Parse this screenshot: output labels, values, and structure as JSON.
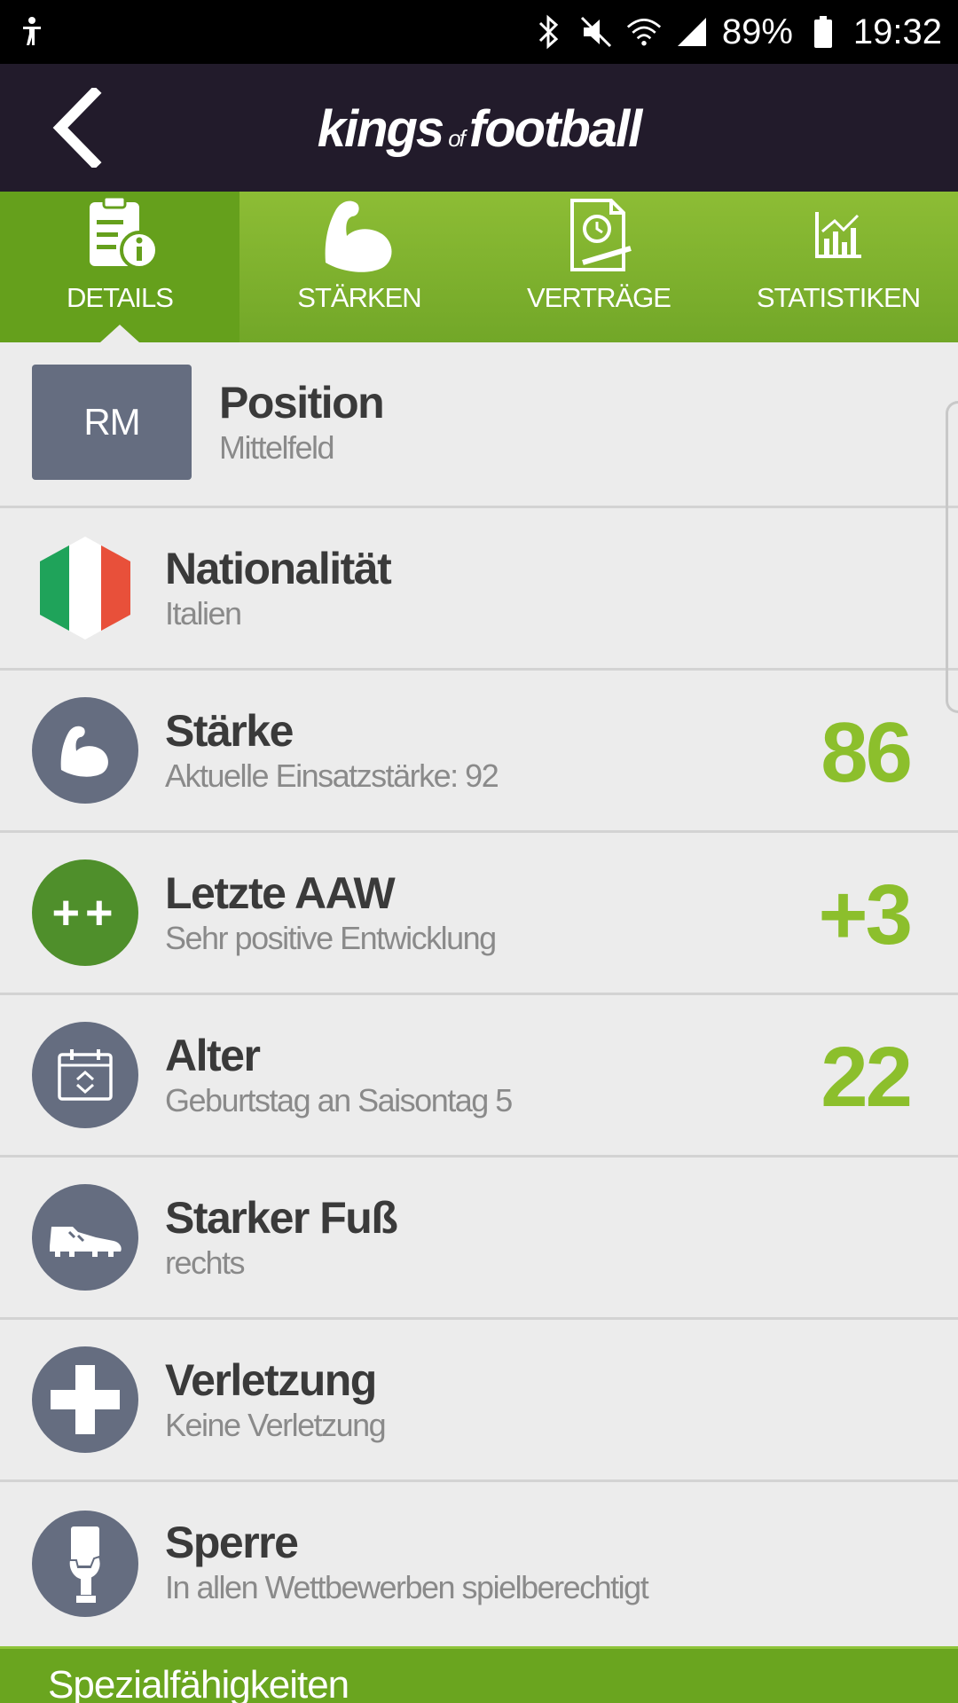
{
  "status": {
    "battery": "89%",
    "time": "19:32"
  },
  "header": {
    "logo_main1": "kings",
    "logo_of": "of",
    "logo_main2": "football"
  },
  "tabs": [
    {
      "label": "DETAILS",
      "icon": "clipboard-info-icon",
      "active": true
    },
    {
      "label": "STÄRKEN",
      "icon": "biceps-icon",
      "active": false
    },
    {
      "label": "VERTRÄGE",
      "icon": "contract-icon",
      "active": false
    },
    {
      "label": "STATISTIKEN",
      "icon": "bar-chart-icon",
      "active": false
    }
  ],
  "rows": [
    {
      "title": "Position",
      "subtitle": "Mittelfeld",
      "badge": "RM"
    },
    {
      "title": "Nationalität",
      "subtitle": "Italien",
      "icon": "italy-flag-icon"
    },
    {
      "title": "Stärke",
      "subtitle": "Aktuelle Einsatzstärke: 92",
      "value": "86",
      "icon": "biceps-icon"
    },
    {
      "title": "Letzte AAW",
      "subtitle": "Sehr positive Entwicklung",
      "value": "+3",
      "icon": "plus-plus-icon",
      "icon_text": "++"
    },
    {
      "title": "Alter",
      "subtitle": "Geburtstag an Saisontag 5",
      "value": "22",
      "icon": "calendar-icon"
    },
    {
      "title": "Starker Fuß",
      "subtitle": "rechts",
      "icon": "football-boot-icon"
    },
    {
      "title": "Verletzung",
      "subtitle": "Keine Verletzung",
      "icon": "medical-cross-icon"
    },
    {
      "title": "Sperre",
      "subtitle": "In allen Wettbewerben spielberechtigt",
      "icon": "referee-card-icon"
    }
  ],
  "special": {
    "label": "Spezialfähigkeiten"
  },
  "colors": {
    "header_bg": "#221b2b",
    "tab_green": "#7cb22e",
    "value_green": "#8cbf2c",
    "icon_circle": "#656d80"
  }
}
